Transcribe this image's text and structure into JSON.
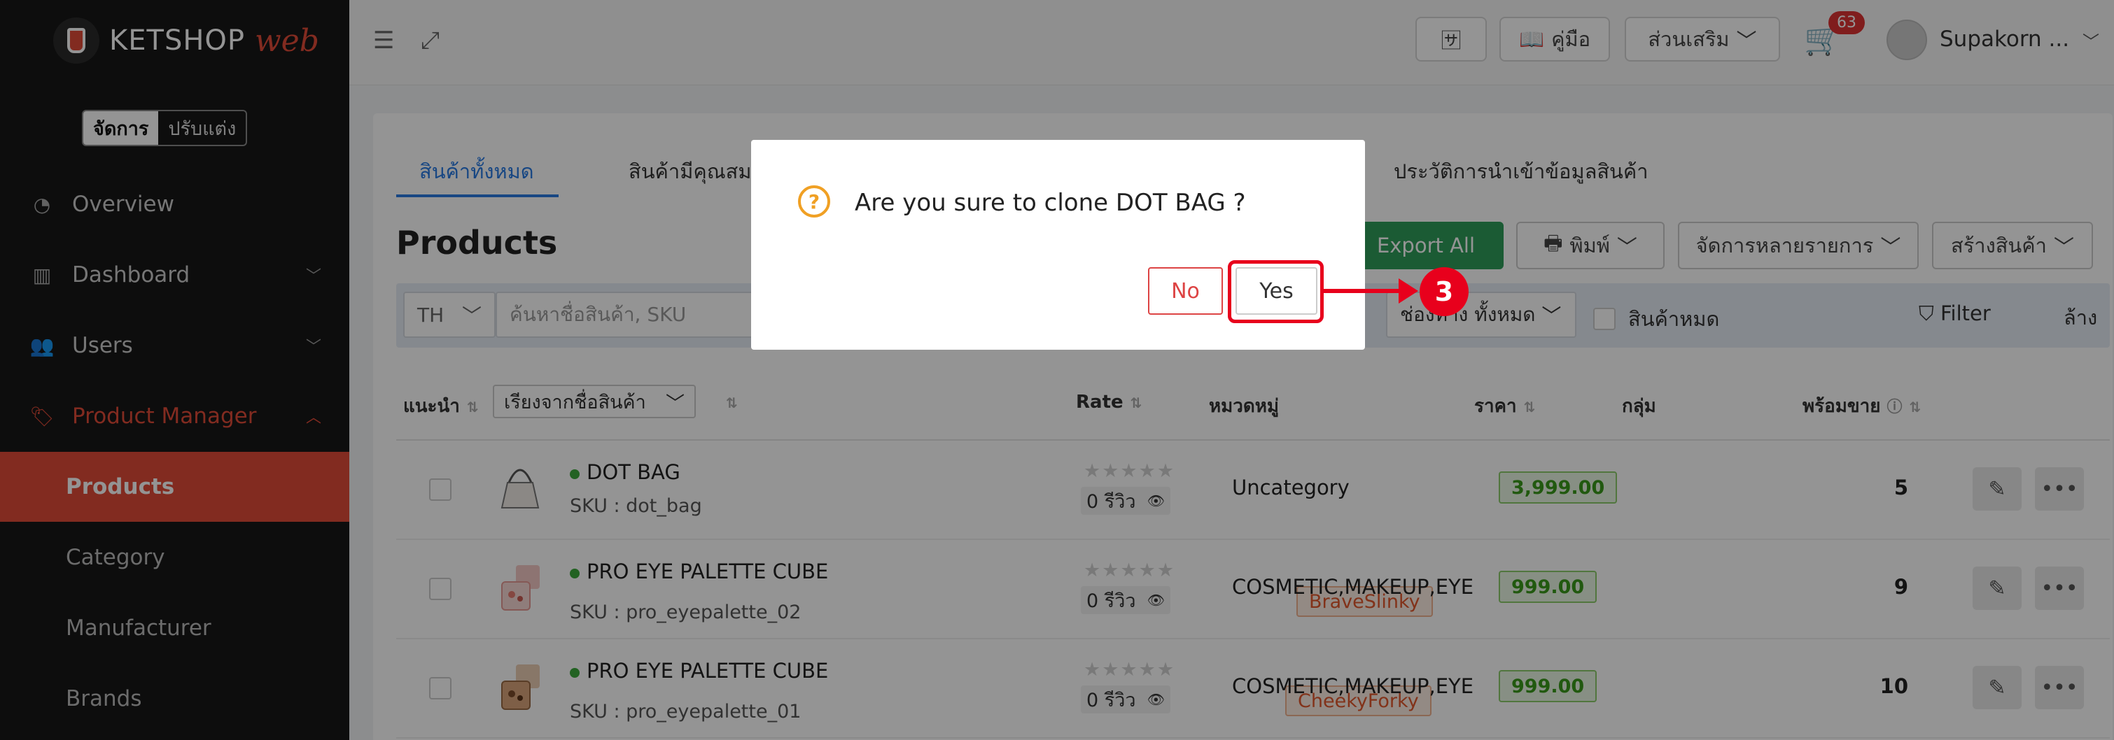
{
  "sidebar": {
    "logo_text": "KETSHOP",
    "logo_accent": "web",
    "mode_active": "จัดการ",
    "mode_inactive": "ปรับแต่ง",
    "nav": [
      {
        "label": "Overview",
        "icon": "pie-chart-icon"
      },
      {
        "label": "Dashboard",
        "icon": "bar-chart-icon"
      },
      {
        "label": "Users",
        "icon": "users-icon"
      },
      {
        "label": "Product Manager",
        "icon": "tags-icon"
      }
    ],
    "sub": [
      {
        "label": "Products"
      },
      {
        "label": "Category"
      },
      {
        "label": "Manufacturer"
      },
      {
        "label": "Brands"
      }
    ]
  },
  "topbar": {
    "manual_label": "คู่มือ",
    "addons_label": "ส่วนเสริม",
    "cart_count": "63",
    "user_name": "Supakorn ..."
  },
  "tabs": {
    "all": "สินค้าทั้งหมด",
    "featured": "สินค้ามีคุณสม",
    "import_history": "ประวัติการนำเข้าข้อมูลสินค้า"
  },
  "page": {
    "title": "Products",
    "export_all": "Export All",
    "print": "พิมพ์",
    "bulk_manage": "จัดการหลายรายการ",
    "create_product": "สร้างสินค้า"
  },
  "filters": {
    "lang": "TH",
    "search_placeholder": "ค้นหาชื่อสินค้า, SKU",
    "channel_label": "ช่องทาง",
    "channel_value": "ทั้งหมด",
    "out_of_stock": "สินค้าหมด",
    "filter_label": "Filter",
    "clear_label": "ล้าง"
  },
  "table": {
    "col_recommend": "แนะนำ",
    "sort_select": "เรียงจากชื่อสินค้า",
    "col_rate": "Rate",
    "col_category": "หมวดหมู่",
    "col_price": "ราคา",
    "col_group": "กลุ่ม",
    "col_ready": "พร้อมขาย",
    "rows": [
      {
        "name": "DOT BAG",
        "sku": "SKU : dot_bag",
        "tag": "",
        "reviews": "0 รีวิว",
        "category": "Uncategory",
        "price": "3,999.00",
        "qty": "5"
      },
      {
        "name": "PRO EYE PALETTE CUBE",
        "sku": "SKU : pro_eyepalette_02",
        "tag": "BraveSlinky",
        "reviews": "0 รีวิว",
        "category": "COSMETIC,MAKEUP,EYE",
        "price": "999.00",
        "qty": "9"
      },
      {
        "name": "PRO EYE PALETTE CUBE",
        "sku": "SKU : pro_eyepalette_01",
        "tag": "CheekyForky",
        "reviews": "0 รีวิว",
        "category": "COSMETIC,MAKEUP,EYE",
        "price": "999.00",
        "qty": "10"
      }
    ]
  },
  "dialog": {
    "message": "Are you sure to clone DOT BAG ?",
    "no_label": "No",
    "yes_label": "Yes"
  },
  "annotation": {
    "step": "3"
  },
  "colors": {
    "accent": "#e04a37",
    "tab_blue": "#2a7ae2",
    "export_green": "#2f9e5b",
    "annotation_red": "#e8001c"
  }
}
